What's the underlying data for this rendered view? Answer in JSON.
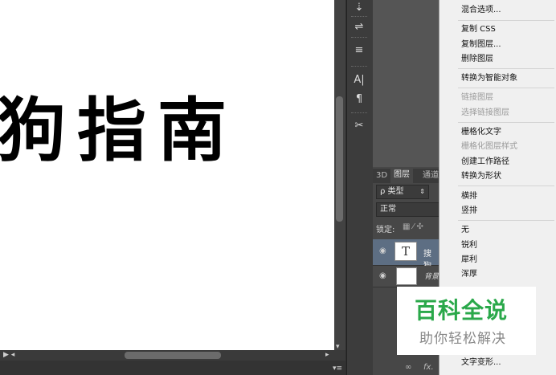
{
  "canvas": {
    "text": "狗指南"
  },
  "toolstrip": {
    "icons": [
      "brush-cursor-icon",
      "adjust-icon",
      "align-icon",
      "character-icon",
      "paragraph-icon",
      "tools-icon"
    ],
    "character_glyph": "A|",
    "paragraph_glyph": "¶"
  },
  "layers_panel": {
    "tabs": [
      "3D",
      "图层",
      "通道"
    ],
    "filter_label": "ρ 类型",
    "blend_mode": "正常",
    "lock_label": "锁定:",
    "layers": [
      {
        "name": "搜狗",
        "thumb": "T"
      },
      {
        "name": "背景",
        "thumb": ""
      }
    ],
    "footer_glyphs": [
      "∞",
      "fx."
    ]
  },
  "context_menu": {
    "items": [
      {
        "label": "混合选项...",
        "disabled": false
      },
      {
        "label": "复制 CSS",
        "disabled": false
      },
      {
        "label": "复制图层...",
        "disabled": false
      },
      {
        "label": "删除图层",
        "disabled": false
      },
      {
        "label": "转换为智能对象",
        "disabled": false
      },
      {
        "label": "链接图层",
        "disabled": true
      },
      {
        "label": "选择链接图层",
        "disabled": true
      },
      {
        "label": "栅格化文字",
        "disabled": false
      },
      {
        "label": "栅格化图层样式",
        "disabled": true
      },
      {
        "label": "创建工作路径",
        "disabled": false
      },
      {
        "label": "转换为形状",
        "disabled": false
      },
      {
        "label": "横排",
        "disabled": false
      },
      {
        "label": "竖排",
        "disabled": false
      },
      {
        "label": "无",
        "disabled": false
      },
      {
        "label": "锐利",
        "disabled": false
      },
      {
        "label": "犀利",
        "disabled": false
      },
      {
        "label": "浑厚",
        "disabled": false
      },
      {
        "label": "文字变形...",
        "disabled": false
      }
    ]
  },
  "watermark": {
    "title": "百科全说",
    "subtitle": "助你轻松解决"
  },
  "colors": {
    "menu_bg": "#f0f0f0",
    "watermark_green": "#2aa84a",
    "selected_layer": "#5d6e83"
  }
}
